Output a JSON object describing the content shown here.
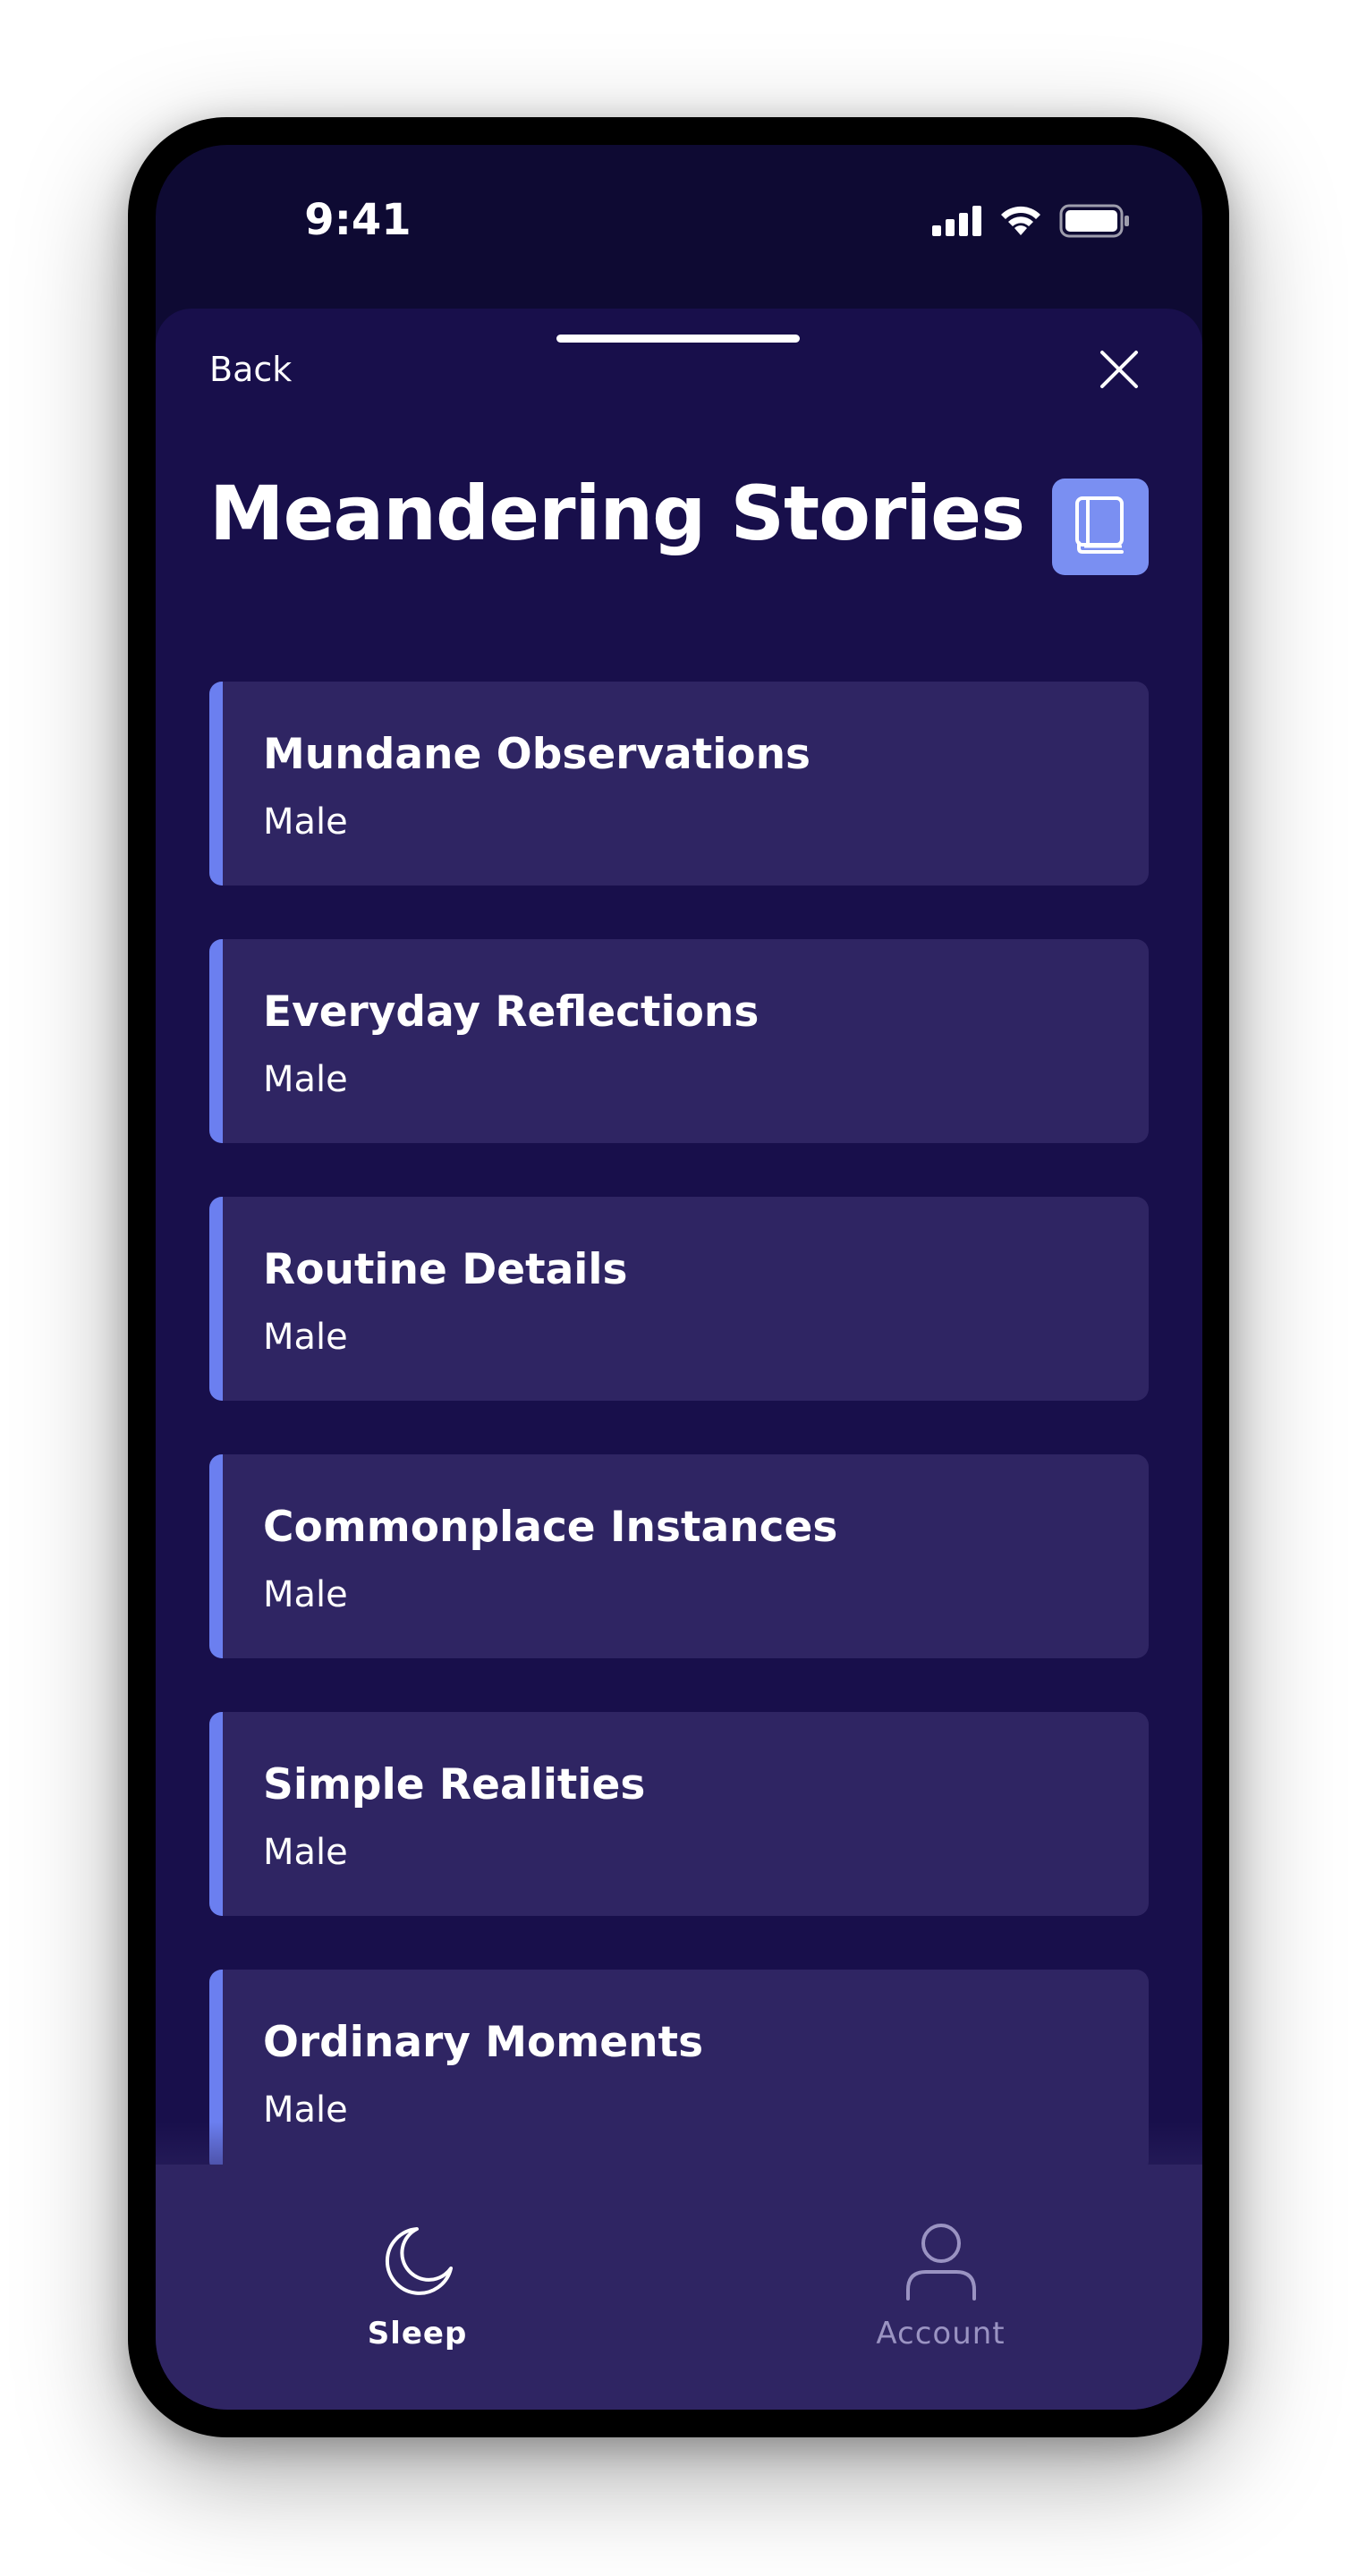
{
  "status_bar": {
    "time": "9:41"
  },
  "header": {
    "back_label": "Back",
    "title": "Meandering Stories",
    "close_icon": "close-icon",
    "badge_icon": "book-icon"
  },
  "stories": [
    {
      "title": "Mundane Observations",
      "voice": "Male"
    },
    {
      "title": "Everyday Reflections",
      "voice": "Male"
    },
    {
      "title": "Routine Details",
      "voice": "Male"
    },
    {
      "title": "Commonplace Instances",
      "voice": "Male"
    },
    {
      "title": "Simple Realities",
      "voice": "Male"
    },
    {
      "title": "Ordinary Moments",
      "voice": "Male"
    }
  ],
  "tabs": [
    {
      "label": "Sleep",
      "icon": "moon-icon",
      "active": true
    },
    {
      "label": "Account",
      "icon": "user-icon",
      "active": false
    }
  ],
  "colors": {
    "background": "#0e0a33",
    "sheet": "#180f4b",
    "card": "#2f2563",
    "accent": "#6b7ff0",
    "badge": "#7a8ff2",
    "inactive_tab": "#9a93c2"
  }
}
